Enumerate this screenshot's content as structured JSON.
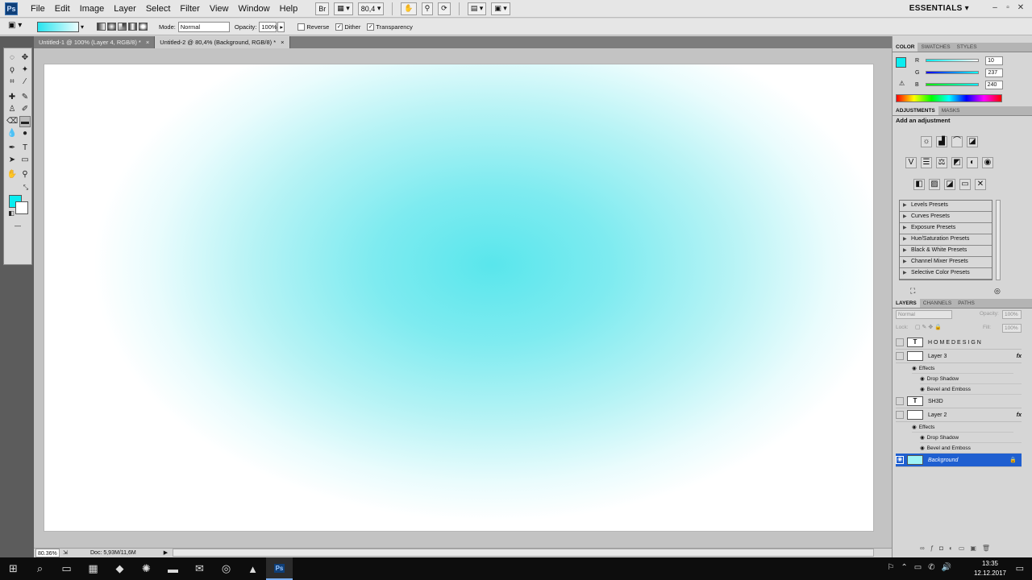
{
  "app": {
    "logo": "Ps"
  },
  "menubar": {
    "items": [
      "File",
      "Edit",
      "Image",
      "Layer",
      "Select",
      "Filter",
      "View",
      "Window",
      "Help"
    ],
    "zoom": "80,4",
    "workspace": "ESSENTIALS"
  },
  "options": {
    "mode_label": "Mode:",
    "mode_value": "Normal",
    "opacity_label": "Opacity:",
    "opacity_value": "100%",
    "reverse_label": "Reverse",
    "dither_label": "Dither",
    "transparency_label": "Transparency",
    "reverse_checked": false,
    "dither_checked": true,
    "transparency_checked": true
  },
  "tabs": [
    {
      "label": "Untitled-1 @ 100% (Layer 4, RGB/8) *",
      "close": "×"
    },
    {
      "label": "Untitled-2 @ 80,4% (Background, RGB/8) *",
      "close": "×"
    }
  ],
  "status": {
    "zoom": "80.36%",
    "doc": "Doc: 5,93M/11,6M"
  },
  "colors": {
    "foreground": "#0aedf0",
    "background": "#ffffff",
    "selection": "#1f5fd0"
  },
  "color_panel": {
    "tabs": [
      "COLOR",
      "SWATCHES",
      "STYLES"
    ],
    "r_label": "R",
    "r_value": "10",
    "g_label": "G",
    "g_value": "237",
    "b_label": "B",
    "b_value": "240"
  },
  "adjustments": {
    "tabs": [
      "ADJUSTMENTS",
      "MASKS"
    ],
    "title": "Add an adjustment",
    "presets": [
      "Levels Presets",
      "Curves Presets",
      "Exposure Presets",
      "Hue/Saturation Presets",
      "Black & White Presets",
      "Channel Mixer Presets",
      "Selective Color Presets"
    ]
  },
  "layers_panel": {
    "tabs": [
      "LAYERS",
      "CHANNELS",
      "PATHS"
    ],
    "blend": "Normal",
    "opacity_label": "Opacity:",
    "opacity_value": "100%",
    "lock_label": "Lock:",
    "fill_label": "Fill:",
    "fill_value": "100%",
    "layers": [
      {
        "name": "HOMEDESIGN",
        "thumb": "T"
      },
      {
        "name": "Layer 3",
        "thumb": ""
      },
      {
        "name": "SH3D",
        "thumb": "T"
      },
      {
        "name": "Layer 2",
        "thumb": ""
      },
      {
        "name": "Background",
        "thumb": ""
      }
    ],
    "effects_label": "Effects",
    "effect_drop_shadow": "Drop Shadow",
    "effect_bevel": "Bevel and Emboss",
    "fx": "fx"
  },
  "taskbar": {
    "time": "13:35",
    "date": "12.12.2017"
  }
}
